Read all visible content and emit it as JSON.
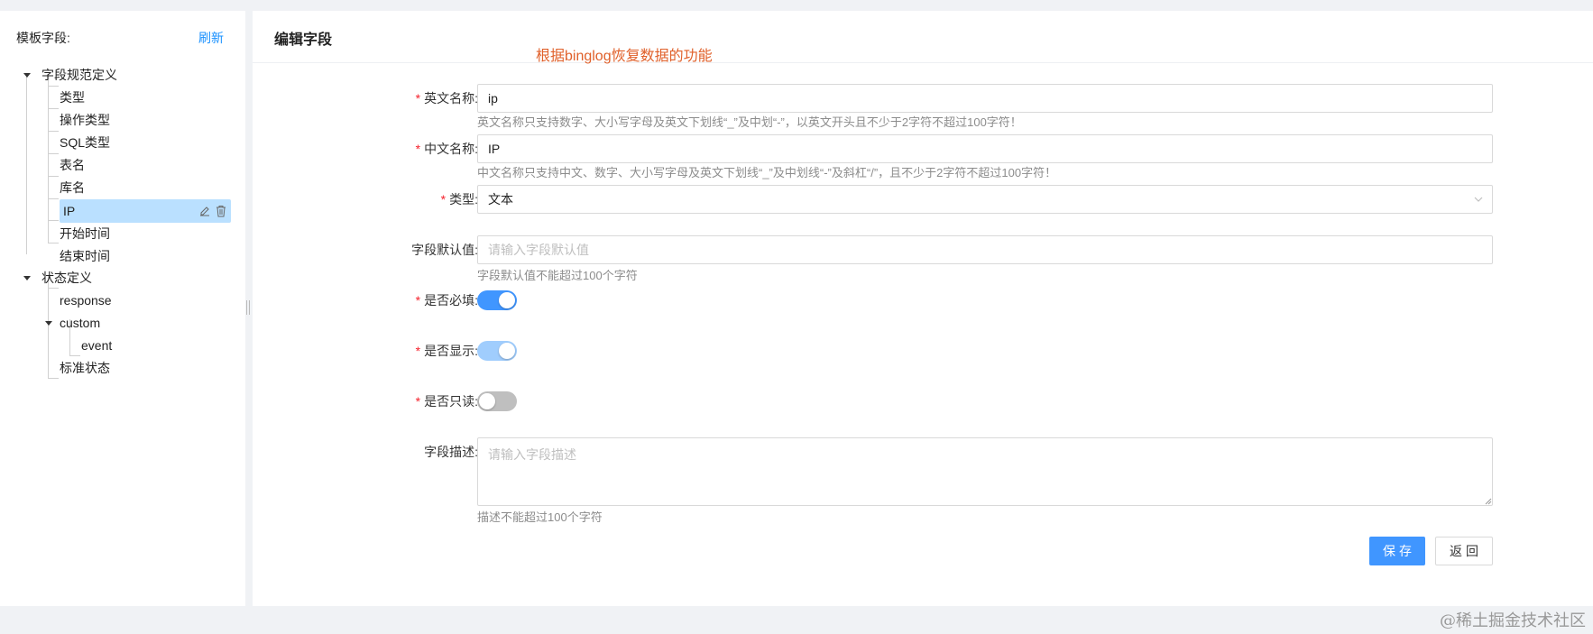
{
  "sidebar": {
    "title": "模板字段:",
    "refresh_label": "刷新",
    "tree": [
      {
        "label": "字段规范定义",
        "children": [
          "类型",
          "操作类型",
          "SQL类型",
          "表名",
          "库名",
          "IP",
          "开始时间",
          "结束时间"
        ]
      },
      {
        "label": "状态定义",
        "children": [
          "response",
          "custom",
          "event",
          "标准状态"
        ]
      }
    ],
    "nodes": {
      "field_spec": "字段规范定义",
      "type": "类型",
      "op_type": "操作类型",
      "sql_type": "SQL类型",
      "table_name": "表名",
      "db_name": "库名",
      "ip": "IP",
      "start_time": "开始时间",
      "end_time": "结束时间",
      "state_def": "状态定义",
      "response": "response",
      "custom": "custom",
      "event": "event",
      "standard_state": "标准状态"
    },
    "selected": "IP"
  },
  "header": {
    "title": "编辑字段",
    "annotation": "根据binglog恢复数据的功能"
  },
  "form": {
    "en_name": {
      "label": "英文名称:",
      "value": "ip",
      "help": "英文名称只支持数字、大小写字母及英文下划线“_”及中划“-”，以英文开头且不少于2字符不超过100字符！"
    },
    "cn_name": {
      "label": "中文名称:",
      "value": "IP",
      "help": "中文名称只支持中文、数字、大小写字母及英文下划线“_”及中划线“-”及斜杠“/”，且不少于2字符不超过100字符！"
    },
    "type": {
      "label": "类型:",
      "value": "文本"
    },
    "default_value": {
      "label": "字段默认值:",
      "placeholder": "请输入字段默认值",
      "help": "字段默认值不能超过100个字符"
    },
    "required": {
      "label": "是否必填:",
      "on": true
    },
    "visible": {
      "label": "是否显示:",
      "on": true,
      "disabled": true
    },
    "readonly": {
      "label": "是否只读:",
      "on": false
    },
    "description": {
      "label": "字段描述:",
      "placeholder": "请输入字段描述",
      "help": "描述不能超过100个字符"
    },
    "save_label": "保存",
    "back_label": "返回"
  },
  "footer": {
    "watermark": "@稀土掘金技术社区"
  },
  "colors": {
    "primary": "#4096ff",
    "selected_bg": "#bae0ff",
    "required_star": "#f5222d",
    "annotation": "#e0602a",
    "switch_off": "#bfbfbf"
  }
}
